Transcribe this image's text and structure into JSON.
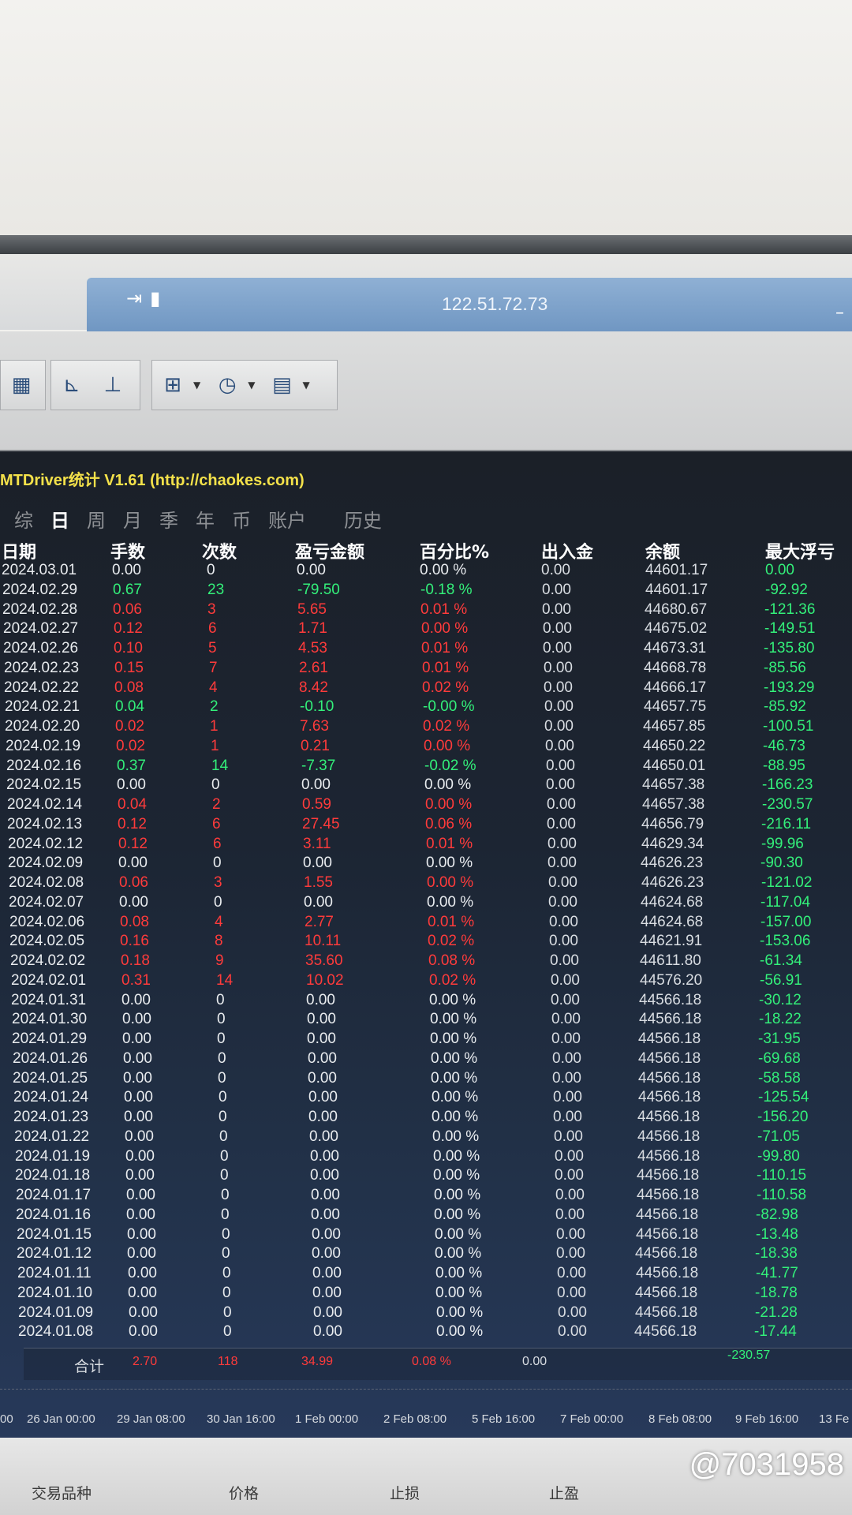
{
  "window": {
    "title": "122.51.72.73"
  },
  "panel": {
    "header": "MTDriver统计 V1.61  (http://chaokes.com)"
  },
  "tabs": [
    "综",
    "日",
    "周",
    "月",
    "季",
    "年",
    "币",
    "账户",
    "历史"
  ],
  "columns": [
    "日期",
    "手数",
    "次数",
    "盈亏金额",
    "百分比%",
    "出入金",
    "余额",
    "最大浮亏"
  ],
  "rows": [
    {
      "date": "2024.03.01",
      "lots": "0.00",
      "count": "0",
      "pl": "0.00",
      "pct": "0.00 %",
      "io": "0.00",
      "bal": "44601.17",
      "dd": "0.00",
      "c": "white"
    },
    {
      "date": "2024.02.29",
      "lots": "0.67",
      "count": "23",
      "pl": "-79.50",
      "pct": "-0.18 %",
      "io": "0.00",
      "bal": "44601.17",
      "dd": "-92.92",
      "c": "green"
    },
    {
      "date": "2024.02.28",
      "lots": "0.06",
      "count": "3",
      "pl": "5.65",
      "pct": "0.01 %",
      "io": "0.00",
      "bal": "44680.67",
      "dd": "-121.36",
      "c": "red"
    },
    {
      "date": "2024.02.27",
      "lots": "0.12",
      "count": "6",
      "pl": "1.71",
      "pct": "0.00 %",
      "io": "0.00",
      "bal": "44675.02",
      "dd": "-149.51",
      "c": "red"
    },
    {
      "date": "2024.02.26",
      "lots": "0.10",
      "count": "5",
      "pl": "4.53",
      "pct": "0.01 %",
      "io": "0.00",
      "bal": "44673.31",
      "dd": "-135.80",
      "c": "red"
    },
    {
      "date": "2024.02.23",
      "lots": "0.15",
      "count": "7",
      "pl": "2.61",
      "pct": "0.01 %",
      "io": "0.00",
      "bal": "44668.78",
      "dd": "-85.56",
      "c": "red"
    },
    {
      "date": "2024.02.22",
      "lots": "0.08",
      "count": "4",
      "pl": "8.42",
      "pct": "0.02 %",
      "io": "0.00",
      "bal": "44666.17",
      "dd": "-193.29",
      "c": "red"
    },
    {
      "date": "2024.02.21",
      "lots": "0.04",
      "count": "2",
      "pl": "-0.10",
      "pct": "-0.00 %",
      "io": "0.00",
      "bal": "44657.75",
      "dd": "-85.92",
      "c": "green"
    },
    {
      "date": "2024.02.20",
      "lots": "0.02",
      "count": "1",
      "pl": "7.63",
      "pct": "0.02 %",
      "io": "0.00",
      "bal": "44657.85",
      "dd": "-100.51",
      "c": "red"
    },
    {
      "date": "2024.02.19",
      "lots": "0.02",
      "count": "1",
      "pl": "0.21",
      "pct": "0.00 %",
      "io": "0.00",
      "bal": "44650.22",
      "dd": "-46.73",
      "c": "red"
    },
    {
      "date": "2024.02.16",
      "lots": "0.37",
      "count": "14",
      "pl": "-7.37",
      "pct": "-0.02 %",
      "io": "0.00",
      "bal": "44650.01",
      "dd": "-88.95",
      "c": "green"
    },
    {
      "date": "2024.02.15",
      "lots": "0.00",
      "count": "0",
      "pl": "0.00",
      "pct": "0.00 %",
      "io": "0.00",
      "bal": "44657.38",
      "dd": "-166.23",
      "c": "white"
    },
    {
      "date": "2024.02.14",
      "lots": "0.04",
      "count": "2",
      "pl": "0.59",
      "pct": "0.00 %",
      "io": "0.00",
      "bal": "44657.38",
      "dd": "-230.57",
      "c": "red"
    },
    {
      "date": "2024.02.13",
      "lots": "0.12",
      "count": "6",
      "pl": "27.45",
      "pct": "0.06 %",
      "io": "0.00",
      "bal": "44656.79",
      "dd": "-216.11",
      "c": "red"
    },
    {
      "date": "2024.02.12",
      "lots": "0.12",
      "count": "6",
      "pl": "3.11",
      "pct": "0.01 %",
      "io": "0.00",
      "bal": "44629.34",
      "dd": "-99.96",
      "c": "red"
    },
    {
      "date": "2024.02.09",
      "lots": "0.00",
      "count": "0",
      "pl": "0.00",
      "pct": "0.00 %",
      "io": "0.00",
      "bal": "44626.23",
      "dd": "-90.30",
      "c": "white"
    },
    {
      "date": "2024.02.08",
      "lots": "0.06",
      "count": "3",
      "pl": "1.55",
      "pct": "0.00 %",
      "io": "0.00",
      "bal": "44626.23",
      "dd": "-121.02",
      "c": "red"
    },
    {
      "date": "2024.02.07",
      "lots": "0.00",
      "count": "0",
      "pl": "0.00",
      "pct": "0.00 %",
      "io": "0.00",
      "bal": "44624.68",
      "dd": "-117.04",
      "c": "white"
    },
    {
      "date": "2024.02.06",
      "lots": "0.08",
      "count": "4",
      "pl": "2.77",
      "pct": "0.01 %",
      "io": "0.00",
      "bal": "44624.68",
      "dd": "-157.00",
      "c": "red"
    },
    {
      "date": "2024.02.05",
      "lots": "0.16",
      "count": "8",
      "pl": "10.11",
      "pct": "0.02 %",
      "io": "0.00",
      "bal": "44621.91",
      "dd": "-153.06",
      "c": "red"
    },
    {
      "date": "2024.02.02",
      "lots": "0.18",
      "count": "9",
      "pl": "35.60",
      "pct": "0.08 %",
      "io": "0.00",
      "bal": "44611.80",
      "dd": "-61.34",
      "c": "red"
    },
    {
      "date": "2024.02.01",
      "lots": "0.31",
      "count": "14",
      "pl": "10.02",
      "pct": "0.02 %",
      "io": "0.00",
      "bal": "44576.20",
      "dd": "-56.91",
      "c": "red"
    },
    {
      "date": "2024.01.31",
      "lots": "0.00",
      "count": "0",
      "pl": "0.00",
      "pct": "0.00 %",
      "io": "0.00",
      "bal": "44566.18",
      "dd": "-30.12",
      "c": "white"
    },
    {
      "date": "2024.01.30",
      "lots": "0.00",
      "count": "0",
      "pl": "0.00",
      "pct": "0.00 %",
      "io": "0.00",
      "bal": "44566.18",
      "dd": "-18.22",
      "c": "white"
    },
    {
      "date": "2024.01.29",
      "lots": "0.00",
      "count": "0",
      "pl": "0.00",
      "pct": "0.00 %",
      "io": "0.00",
      "bal": "44566.18",
      "dd": "-31.95",
      "c": "white"
    },
    {
      "date": "2024.01.26",
      "lots": "0.00",
      "count": "0",
      "pl": "0.00",
      "pct": "0.00 %",
      "io": "0.00",
      "bal": "44566.18",
      "dd": "-69.68",
      "c": "white"
    },
    {
      "date": "2024.01.25",
      "lots": "0.00",
      "count": "0",
      "pl": "0.00",
      "pct": "0.00 %",
      "io": "0.00",
      "bal": "44566.18",
      "dd": "-58.58",
      "c": "white"
    },
    {
      "date": "2024.01.24",
      "lots": "0.00",
      "count": "0",
      "pl": "0.00",
      "pct": "0.00 %",
      "io": "0.00",
      "bal": "44566.18",
      "dd": "-125.54",
      "c": "white"
    },
    {
      "date": "2024.01.23",
      "lots": "0.00",
      "count": "0",
      "pl": "0.00",
      "pct": "0.00 %",
      "io": "0.00",
      "bal": "44566.18",
      "dd": "-156.20",
      "c": "white"
    },
    {
      "date": "2024.01.22",
      "lots": "0.00",
      "count": "0",
      "pl": "0.00",
      "pct": "0.00 %",
      "io": "0.00",
      "bal": "44566.18",
      "dd": "-71.05",
      "c": "white"
    },
    {
      "date": "2024.01.19",
      "lots": "0.00",
      "count": "0",
      "pl": "0.00",
      "pct": "0.00 %",
      "io": "0.00",
      "bal": "44566.18",
      "dd": "-99.80",
      "c": "white"
    },
    {
      "date": "2024.01.18",
      "lots": "0.00",
      "count": "0",
      "pl": "0.00",
      "pct": "0.00 %",
      "io": "0.00",
      "bal": "44566.18",
      "dd": "-110.15",
      "c": "white"
    },
    {
      "date": "2024.01.17",
      "lots": "0.00",
      "count": "0",
      "pl": "0.00",
      "pct": "0.00 %",
      "io": "0.00",
      "bal": "44566.18",
      "dd": "-110.58",
      "c": "white"
    },
    {
      "date": "2024.01.16",
      "lots": "0.00",
      "count": "0",
      "pl": "0.00",
      "pct": "0.00 %",
      "io": "0.00",
      "bal": "44566.18",
      "dd": "-82.98",
      "c": "white"
    },
    {
      "date": "2024.01.15",
      "lots": "0.00",
      "count": "0",
      "pl": "0.00",
      "pct": "0.00 %",
      "io": "0.00",
      "bal": "44566.18",
      "dd": "-13.48",
      "c": "white"
    },
    {
      "date": "2024.01.12",
      "lots": "0.00",
      "count": "0",
      "pl": "0.00",
      "pct": "0.00 %",
      "io": "0.00",
      "bal": "44566.18",
      "dd": "-18.38",
      "c": "white"
    },
    {
      "date": "2024.01.11",
      "lots": "0.00",
      "count": "0",
      "pl": "0.00",
      "pct": "0.00 %",
      "io": "0.00",
      "bal": "44566.18",
      "dd": "-41.77",
      "c": "white"
    },
    {
      "date": "2024.01.10",
      "lots": "0.00",
      "count": "0",
      "pl": "0.00",
      "pct": "0.00 %",
      "io": "0.00",
      "bal": "44566.18",
      "dd": "-18.78",
      "c": "white"
    },
    {
      "date": "2024.01.09",
      "lots": "0.00",
      "count": "0",
      "pl": "0.00",
      "pct": "0.00 %",
      "io": "0.00",
      "bal": "44566.18",
      "dd": "-21.28",
      "c": "white"
    },
    {
      "date": "2024.01.08",
      "lots": "0.00",
      "count": "0",
      "pl": "0.00",
      "pct": "0.00 %",
      "io": "0.00",
      "bal": "44566.18",
      "dd": "-17.44",
      "c": "white"
    }
  ],
  "totals": {
    "label": "合计",
    "lots": "2.70",
    "count": "118",
    "pl": "34.99",
    "pct": "0.08 %",
    "io": "0.00",
    "dd": "-230.57"
  },
  "time_axis": [
    "00",
    "26 Jan 00:00",
    "29 Jan 08:00",
    "30 Jan 16:00",
    "1 Feb 00:00",
    "2 Feb 08:00",
    "5 Feb 16:00",
    "7 Feb 00:00",
    "8 Feb 08:00",
    "9 Feb 16:00",
    "13 Fe"
  ],
  "bottom_columns": [
    "交易品种",
    "价格",
    "止损",
    "止盈"
  ],
  "watermark": "@7031958",
  "colors": {
    "profit": "#ff3b3b",
    "loss": "#33f07a",
    "header_text": "#f4e14a",
    "panel_bg": "#1c2533"
  }
}
